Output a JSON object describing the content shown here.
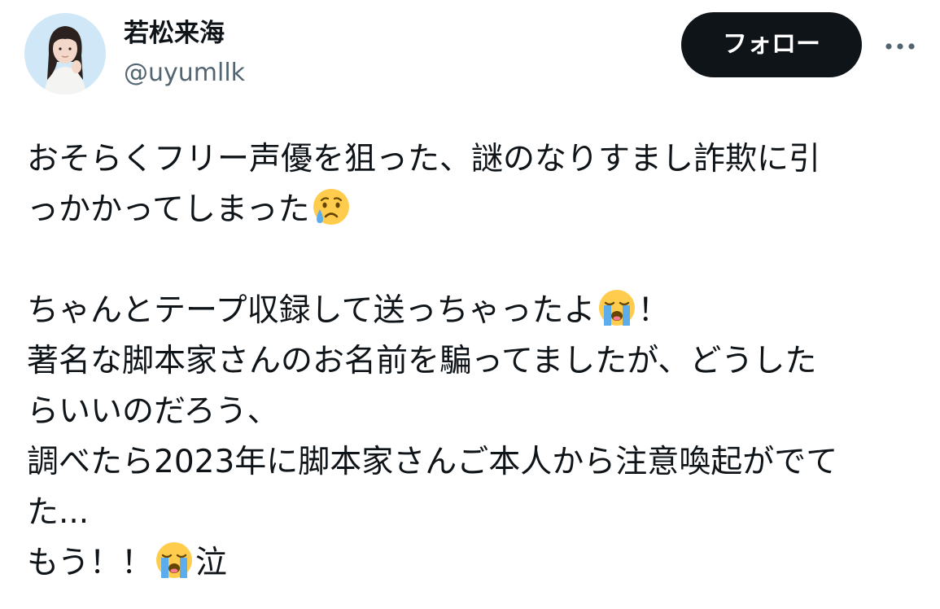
{
  "author": {
    "display_name": "若松来海",
    "handle": "@uyumllk"
  },
  "actions": {
    "follow_label": "フォロー",
    "more_icon": "more-horizontal-icon"
  },
  "tweet": {
    "lines": [
      {
        "pre": "おそらくフリー声優を狙った、謎のなりすまし詐欺に引"
      },
      {
        "pre": "っかかってしまった",
        "emoji": "crying-face-emoji"
      },
      {
        "pre": ""
      },
      {
        "pre": "ちゃんとテープ収録して送っちゃったよ",
        "emoji": "loudly-crying-face-emoji",
        "post": "！"
      },
      {
        "pre": "著名な脚本家さんのお名前を騙ってましたが、どうした"
      },
      {
        "pre": "らいいのだろう、"
      },
      {
        "pre": "調べたら2023年に脚本家さんご本人から注意喚起がでて"
      },
      {
        "pre": "た..."
      },
      {
        "pre": "もう！！",
        "emoji": "loudly-crying-face-emoji",
        "post": "泣"
      }
    ]
  }
}
